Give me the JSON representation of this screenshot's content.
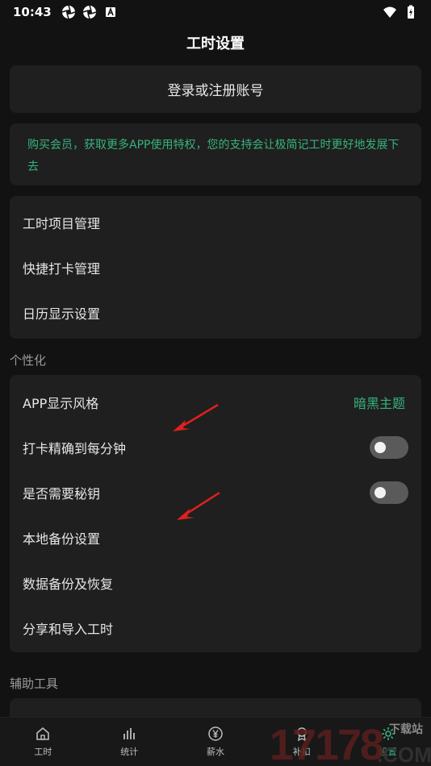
{
  "status_bar": {
    "time": "10:43"
  },
  "header": {
    "title": "工时设置"
  },
  "login": {
    "label": "登录或注册账号"
  },
  "vip": {
    "text": "购买会员，获取更多APP使用特权，您的支持会让极简记工时更好地发展下去"
  },
  "menu_group_1": {
    "items": [
      {
        "label": "工时项目管理"
      },
      {
        "label": "快捷打卡管理"
      },
      {
        "label": "日历显示设置"
      }
    ]
  },
  "section_personal": {
    "label": "个性化"
  },
  "menu_group_2": {
    "items": [
      {
        "label": "APP显示风格",
        "value": "暗黑主题"
      },
      {
        "label": "打卡精确到每分钟",
        "toggle": false
      },
      {
        "label": "是否需要秘钥",
        "toggle": false
      },
      {
        "label": "本地备份设置"
      },
      {
        "label": "数据备份及恢复"
      },
      {
        "label": "分享和导入工时"
      }
    ]
  },
  "section_tools": {
    "label": "辅助工具"
  },
  "bottom_nav": {
    "items": [
      {
        "label": "工时",
        "icon": "home-icon"
      },
      {
        "label": "统计",
        "icon": "stats-icon"
      },
      {
        "label": "薪水",
        "icon": "yen-icon"
      },
      {
        "label": "补扣",
        "icon": "badge-icon"
      },
      {
        "label": "设置",
        "icon": "gear-icon",
        "active": true
      }
    ]
  },
  "watermark": {
    "text": "下载站",
    "brand": "17178.COM"
  },
  "colors": {
    "accent": "#36b37e",
    "background": "#121212",
    "card": "#1f1f1f",
    "arrow": "#e0201e"
  }
}
